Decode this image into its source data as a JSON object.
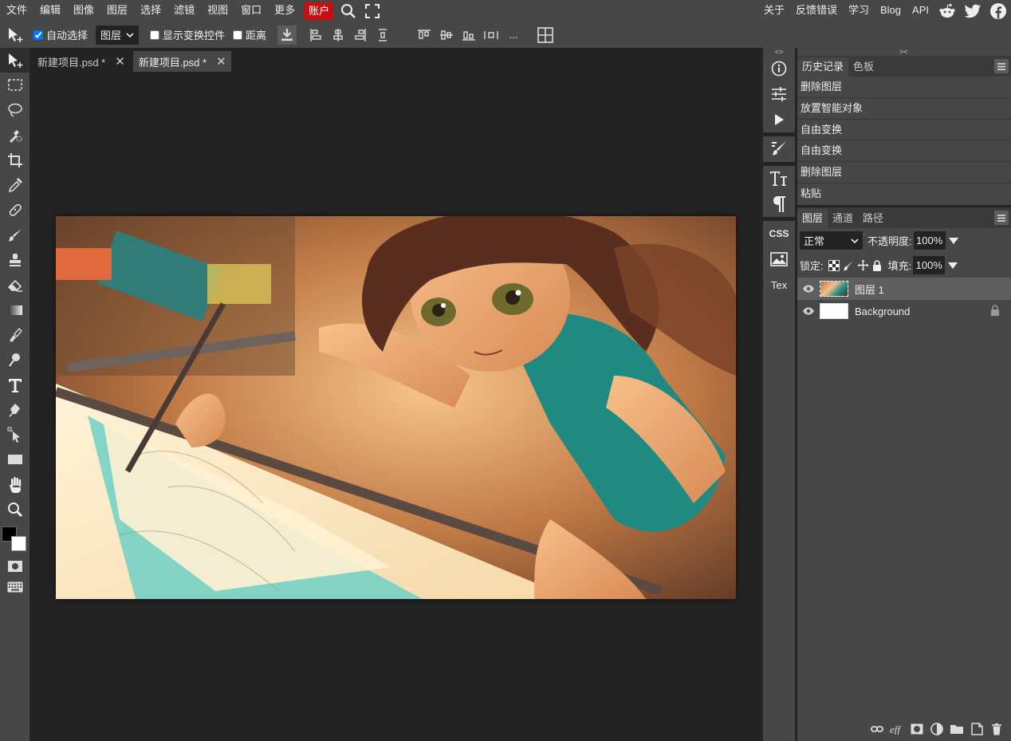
{
  "menu": {
    "items": [
      "文件",
      "编辑",
      "图像",
      "图层",
      "选择",
      "滤镜",
      "视图",
      "窗口",
      "更多"
    ],
    "account": "账户",
    "right": [
      "关于",
      "反馈错误",
      "学习",
      "Blog",
      "API"
    ]
  },
  "options": {
    "auto_select": "自动选择",
    "auto_select_target": "图层",
    "show_transform": "显示变换控件",
    "distance": "距离",
    "more": "..."
  },
  "tabs": [
    {
      "label": "新建项目.psd *",
      "close": "✕"
    },
    {
      "label": "新建项目.psd *",
      "close": "✕"
    }
  ],
  "side_icons": {
    "css": "CSS",
    "tex": "Tex",
    "collapse_left": "<>",
    "collapse_right": "><"
  },
  "history_panel": {
    "tabs": [
      "历史记录",
      "色板"
    ],
    "items": [
      "删除图层",
      "放置智能对象",
      "自由变换",
      "自由变换",
      "删除图层",
      "粘贴"
    ]
  },
  "layers_panel": {
    "tabs": [
      "图层",
      "通道",
      "路径"
    ],
    "blend_mode": "正常",
    "opacity_label": "不透明度:",
    "opacity_value": "100%",
    "lock_label": "锁定:",
    "fill_label": "填充:",
    "fill_value": "100%",
    "layers": [
      {
        "name": "图层 1",
        "selected": true
      },
      {
        "name": "Background",
        "selected": false
      }
    ]
  },
  "colors": {
    "accent_red": "#cc0c0c",
    "panel_bg": "#474747",
    "workspace_bg": "#232323"
  }
}
